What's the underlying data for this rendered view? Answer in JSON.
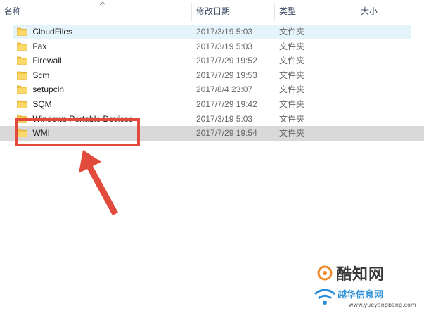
{
  "columns": {
    "name": "名称",
    "date": "修改日期",
    "type": "类型",
    "size": "大小"
  },
  "files": [
    {
      "name": "CloudFiles",
      "date": "2017/3/19 5:03",
      "type": "文件夹",
      "state": "hover"
    },
    {
      "name": "Fax",
      "date": "2017/3/19 5:03",
      "type": "文件夹",
      "state": "normal"
    },
    {
      "name": "Firewall",
      "date": "2017/7/29 19:52",
      "type": "文件夹",
      "state": "normal"
    },
    {
      "name": "Scm",
      "date": "2017/7/29 19:53",
      "type": "文件夹",
      "state": "normal"
    },
    {
      "name": "setupcln",
      "date": "2017/8/4 23:07",
      "type": "文件夹",
      "state": "normal"
    },
    {
      "name": "SQM",
      "date": "2017/7/29 19:42",
      "type": "文件夹",
      "state": "normal"
    },
    {
      "name": "Windows Portable Devices",
      "date": "2017/3/19 5:03",
      "type": "文件夹",
      "state": "normal"
    },
    {
      "name": "WMI",
      "date": "2017/7/29 19:54",
      "type": "文件夹",
      "state": "selected"
    }
  ],
  "watermark": {
    "line1": "酷知网",
    "line2": "越华信息网",
    "url": "www.yueyangbang.com"
  },
  "colors": {
    "hover_bg": "#e5f3fb",
    "selected_bg": "#d9d9d9",
    "annotation_red": "#e24a3b",
    "folder_yellow": "#f7c948"
  }
}
